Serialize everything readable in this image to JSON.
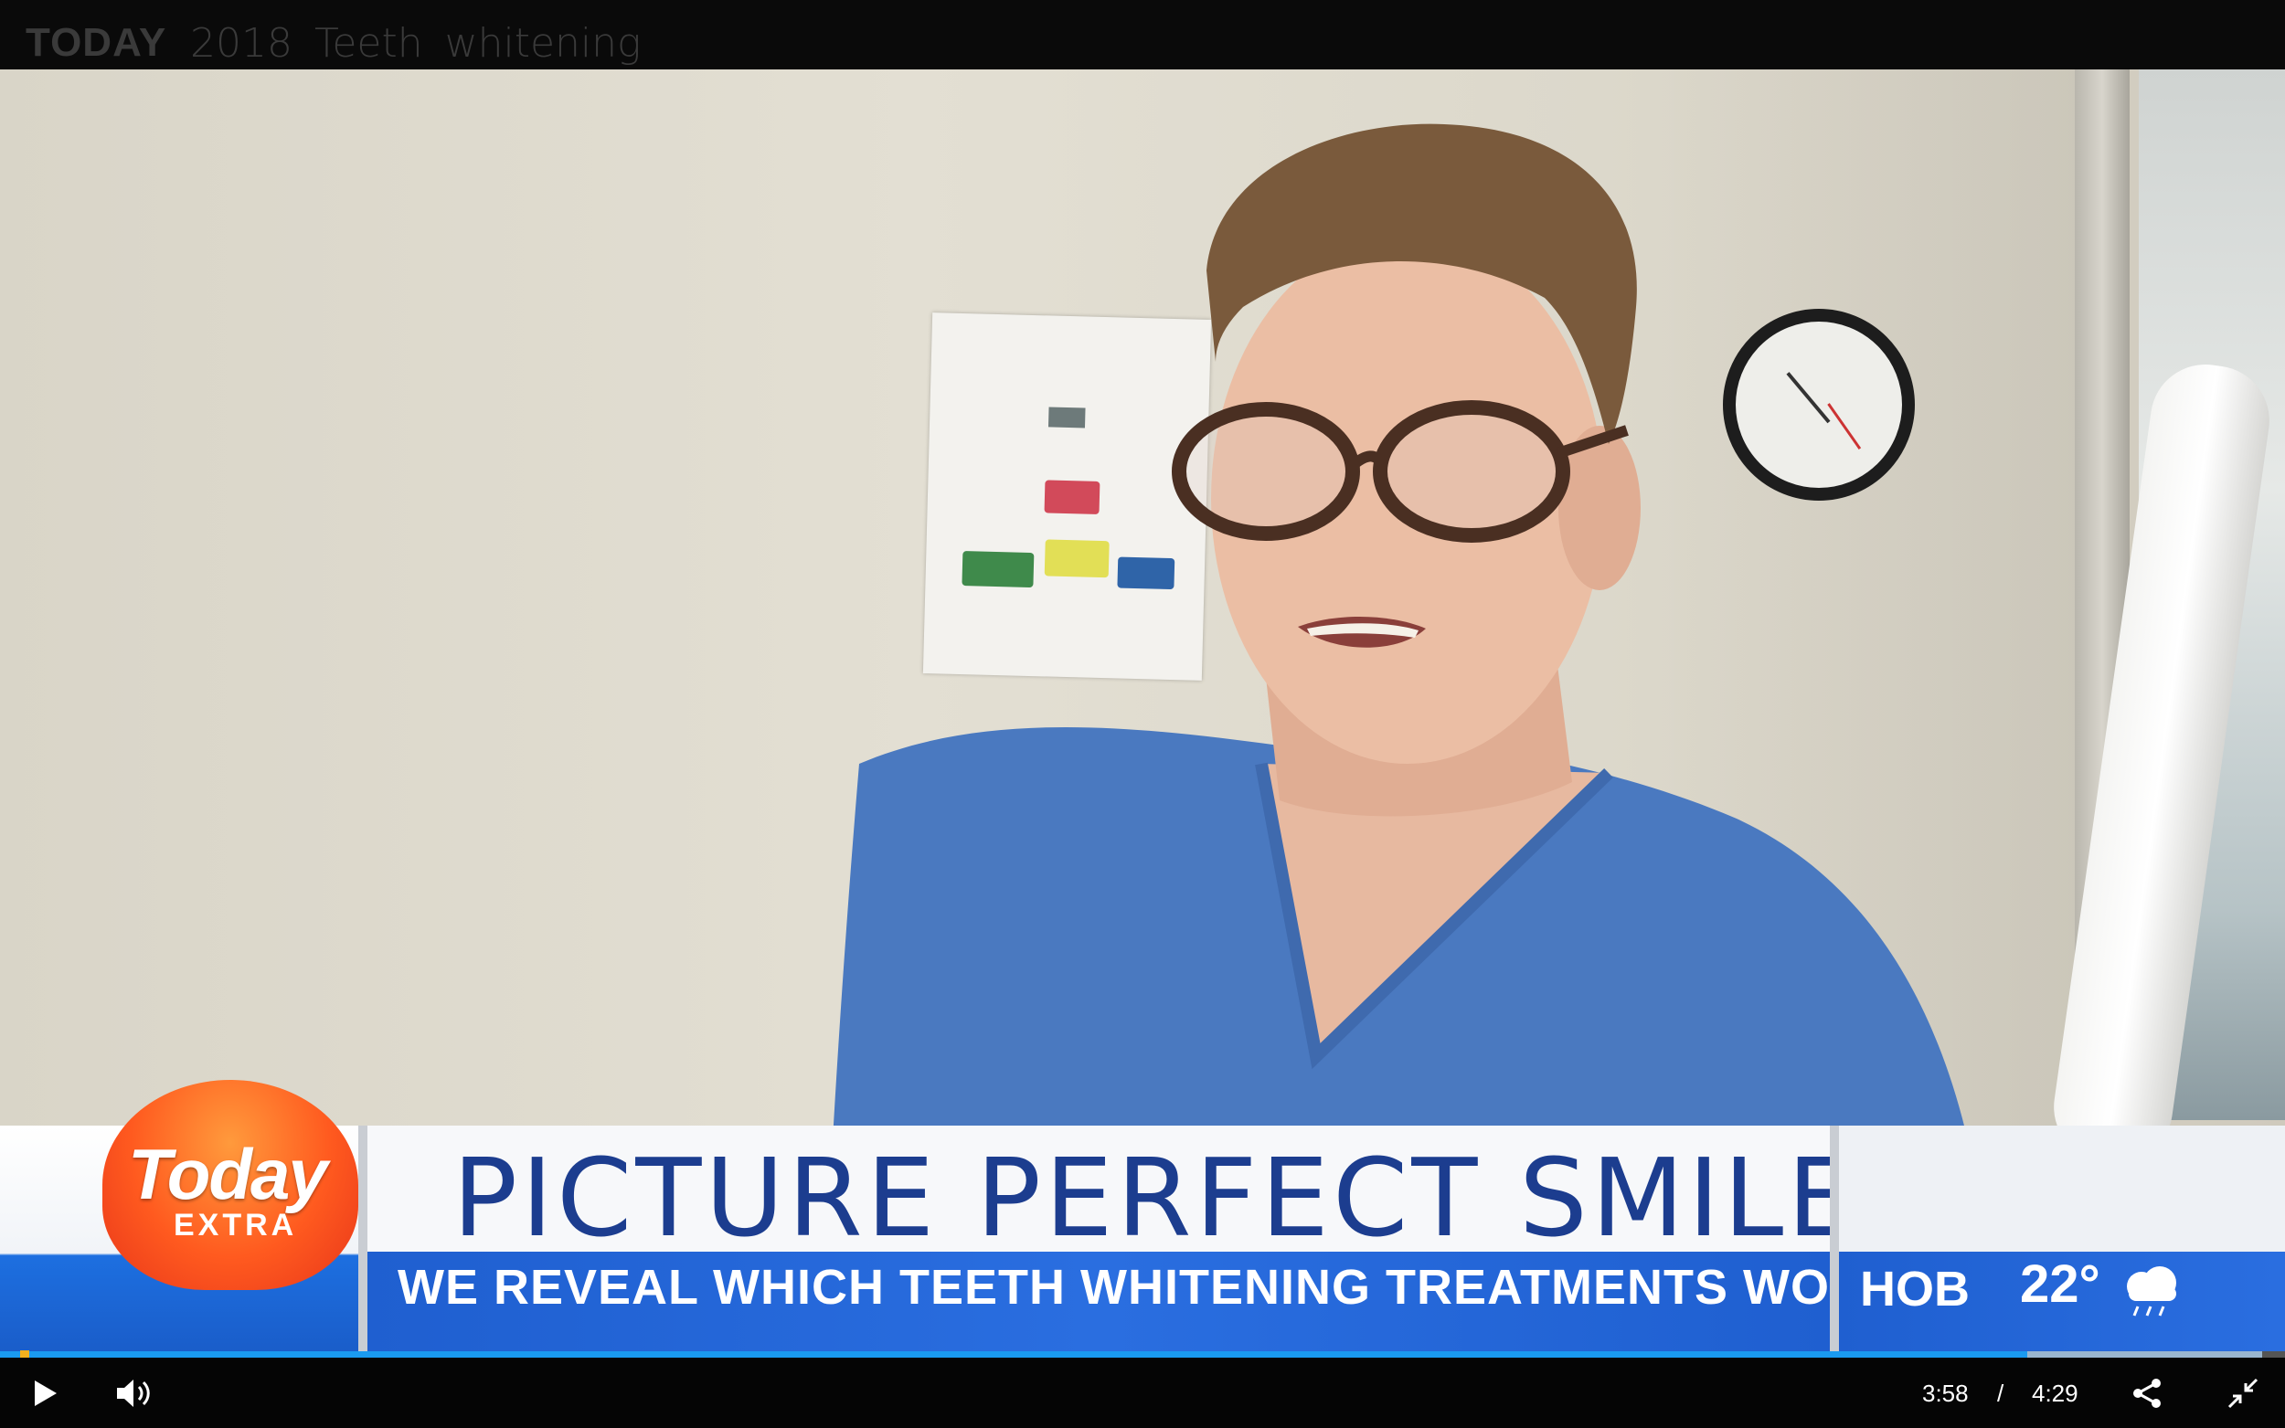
{
  "title_bar": {
    "brand": "TODAY",
    "video_title": "2018 Teeth whitening"
  },
  "lower_third": {
    "logo_word": "Today",
    "logo_sub": "EXTRA",
    "headline": "PICTURE PERFECT SMILE",
    "subheadline": "WE REVEAL WHICH TEETH WHITENING TREATMENTS WORK BEST",
    "weather_city": "HOB",
    "weather_temp": "22°",
    "weather_icon": "cloud-rain-icon"
  },
  "player": {
    "current_time": "3:58",
    "separator": "/",
    "duration": "4:29",
    "progress_fraction": 0.887,
    "buffered_fraction": 0.99,
    "accent_color": "#1a9af0"
  }
}
